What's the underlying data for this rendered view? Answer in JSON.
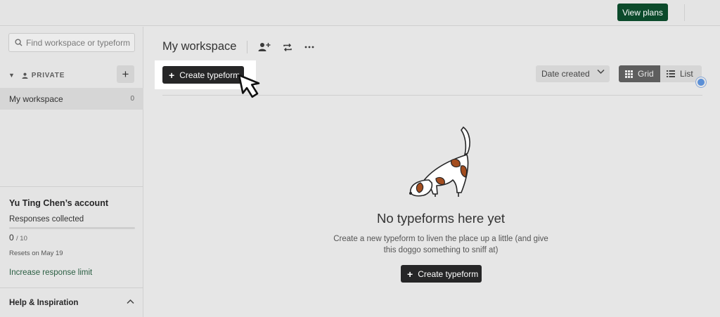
{
  "topbar": {
    "view_plans_label": "View plans"
  },
  "sidebar": {
    "search_placeholder": "Find workspace or typeform",
    "section_label": "PRIVATE",
    "add_label": "+",
    "workspace_item": {
      "label": "My workspace",
      "count": "0"
    },
    "account": {
      "name": "Yu Ting Chen’s account",
      "responses_label": "Responses collected",
      "responses_used": "0",
      "responses_limit": "/ 10",
      "responses_fraction": 0,
      "resets": "Resets on May 19",
      "increase_link": "Increase response limit"
    },
    "help_label": "Help & Inspiration"
  },
  "main": {
    "workspace_title": "My workspace",
    "create_label": "Create typeform",
    "sort_label": "Date created",
    "view_grid_label": "Grid",
    "view_list_label": "List",
    "empty": {
      "title": "No typeforms here yet",
      "text": "Create a new typeform to liven the place up a little (and give this doggo something to sniff at)",
      "button_label": "Create typeform"
    }
  },
  "colors": {
    "brand_green": "#0b4a2b",
    "dark_button": "#262627",
    "link_green": "#2b5f43"
  }
}
